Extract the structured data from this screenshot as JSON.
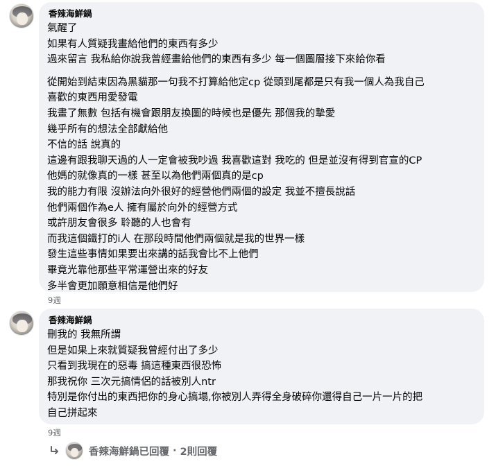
{
  "comment1": {
    "author": "香辣海鮮鍋",
    "lines": [
      "氣醒了",
      "如果有人質疑我畫給他們的東西有多少",
      "過來留言 我私給你說我曾經畫給他們的東西有多少 每一個圖層接下來給你看",
      "",
      "從開始到結束因為黑貓那一句我不打算給他定cp 從頭到尾都是只有我一個人為我自己",
      "喜歡的東西用愛發電",
      "我畫了無數 包括有機會跟朋友換圖的時候也是優先 那個我的摯愛",
      "幾乎所有的想法全部獻給他",
      "不信的話 說真的",
      "這邊有跟我聊天過的人一定會被我吵過 我喜歡這對 我吃的 但是並沒有得到官宣的CP",
      "他媽的就像真的一樣 甚至以為他們兩個真的是cp",
      "我的能力有限 沒辦法向外很好的經營他們兩個的設定 我並不擅長說話",
      "他們兩個作為e人 擁有屬於向外的經營方式",
      "或許朋友會很多 聆聽的人也會有",
      "而我這個鐵打的i人 在那段時間他們兩個就是我的世界一樣",
      "發生這些事情如果要出來講的話我會比不上他們",
      "畢竟光靠他那些平常運營出來的好友",
      "多半會更加願意相信是他們好"
    ],
    "time": "9週"
  },
  "comment2": {
    "author": "香辣海鮮鍋",
    "lines": [
      "刪我的 我無所謂",
      "但是如果上來就質疑我曾經付出了多少",
      "只看到我現在的惡毒 搞這種東西很恐怖",
      "那我祝你 三次元搞情侶的話被別人ntr",
      "特別是你付出的東西把你的身心搞塌,你被別人弄得全身破碎你還得自己一片一片的把",
      "自己拼起來"
    ],
    "time": "9週"
  },
  "replies": {
    "label": "香辣海鮮鍋已回覆",
    "separator": "·",
    "count": "2則回覆",
    "arrow_icon": "reply-arrow-icon"
  }
}
